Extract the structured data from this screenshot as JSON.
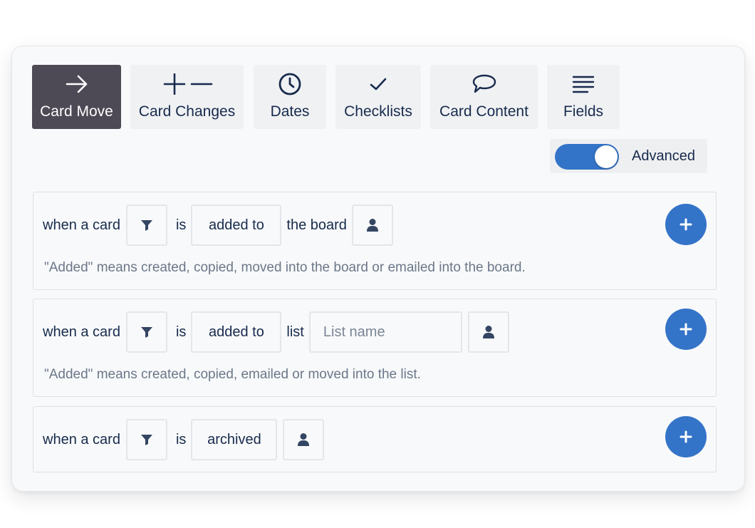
{
  "tabs": [
    {
      "label": "Card Move",
      "icon": "arrow-right-icon",
      "active": true
    },
    {
      "label": "Card Changes",
      "icon": "plus-minus-icon"
    },
    {
      "label": "Dates",
      "icon": "clock-icon"
    },
    {
      "label": "Checklists",
      "icon": "checkmark-icon"
    },
    {
      "label": "Card Content",
      "icon": "speech-bubble-icon"
    },
    {
      "label": "Fields",
      "icon": "lines-icon"
    }
  ],
  "advanced": {
    "label": "Advanced",
    "enabled": true
  },
  "triggers": [
    {
      "prefix": "when a card",
      "is": "is",
      "action": "added to",
      "target": "the board",
      "hint": "\"Added\" means created, copied, moved into the board or emailed into the board."
    },
    {
      "prefix": "when a card",
      "is": "is",
      "action": "added to",
      "target": "list",
      "list_placeholder": "List name",
      "hint": "\"Added\" means created, copied, emailed or moved into the list."
    },
    {
      "prefix": "when a card",
      "is": "is",
      "action": "archived"
    }
  ],
  "colors": {
    "active_tab": "#4d4955",
    "accent": "#3474c8"
  }
}
